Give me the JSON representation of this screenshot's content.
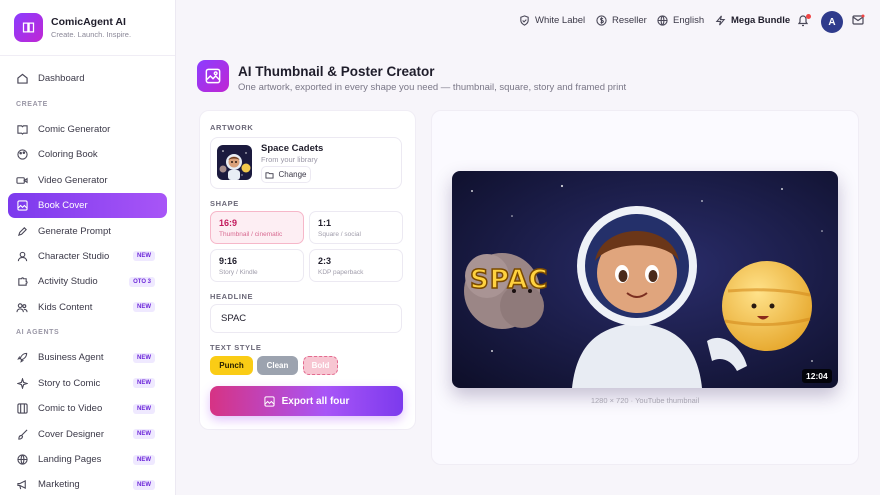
{
  "brand": {
    "title": "ComicAgent AI",
    "subtitle": "Create. Launch. Inspire."
  },
  "sidebar": {
    "items": [
      {
        "label": "Dashboard",
        "icon": "grid-icon"
      },
      {
        "section": "CREATE"
      },
      {
        "label": "Comic Generator",
        "icon": "book-open-icon"
      },
      {
        "label": "Coloring Book",
        "icon": "palette-icon"
      },
      {
        "label": "Video Generator",
        "icon": "video-icon"
      },
      {
        "label": "Book Cover",
        "icon": "image-edit-icon",
        "active": true
      },
      {
        "label": "Generate Prompt",
        "icon": "pen-icon"
      },
      {
        "label": "Character Studio",
        "icon": "user-icon",
        "badge": "NEW"
      },
      {
        "label": "Activity Studio",
        "icon": "puzzle-icon",
        "badge": "OTO 3"
      },
      {
        "label": "Kids Content",
        "icon": "users-icon",
        "badge": "NEW"
      },
      {
        "section": "AI AGENTS"
      },
      {
        "label": "Business Agent",
        "icon": "rocket-icon",
        "badge": "NEW"
      },
      {
        "label": "Story to Comic",
        "icon": "sparkle-icon",
        "badge": "NEW"
      },
      {
        "label": "Comic to Video",
        "icon": "film-icon",
        "badge": "NEW"
      },
      {
        "label": "Cover Designer",
        "icon": "brush-icon",
        "badge": "NEW"
      },
      {
        "label": "Landing Pages",
        "icon": "globe-icon",
        "badge": "NEW"
      },
      {
        "label": "Marketing",
        "icon": "megaphone-icon",
        "badge": "NEW"
      }
    ]
  },
  "header": {
    "white_label": "White Label",
    "reseller": "Reseller",
    "language": "English",
    "bundle": "Mega Bundle",
    "avatar_initial": "A"
  },
  "page": {
    "title": "AI Thumbnail & Poster Creator",
    "subtitle": "One artwork, exported in every shape you need — thumbnail, square, story and framed print"
  },
  "form": {
    "artwork_label": "ARTWORK",
    "artwork_name": "Space Cadets",
    "artwork_source": "From your library",
    "change_label": "Change",
    "shape_label": "SHAPE",
    "shapes": [
      {
        "ratio": "16:9",
        "desc": "Thumbnail / cinematic",
        "active": true
      },
      {
        "ratio": "1:1",
        "desc": "Square / social"
      },
      {
        "ratio": "9:16",
        "desc": "Story / Kindle"
      },
      {
        "ratio": "2:3",
        "desc": "KDP paperback"
      }
    ],
    "headline_label": "HEADLINE",
    "headline_value": "SPAC",
    "text_style_label": "TEXT STYLE",
    "styles": [
      "Punch",
      "Clean",
      "Bold"
    ],
    "export_label": "Export all four"
  },
  "preview": {
    "headline": "SPAC",
    "timestamp": "12:04",
    "caption": "1280 × 720 · YouTube thumbnail"
  },
  "colors": {
    "accent": "#8b3dff",
    "active_shape": "#c2185b",
    "punch": "#facc15"
  }
}
